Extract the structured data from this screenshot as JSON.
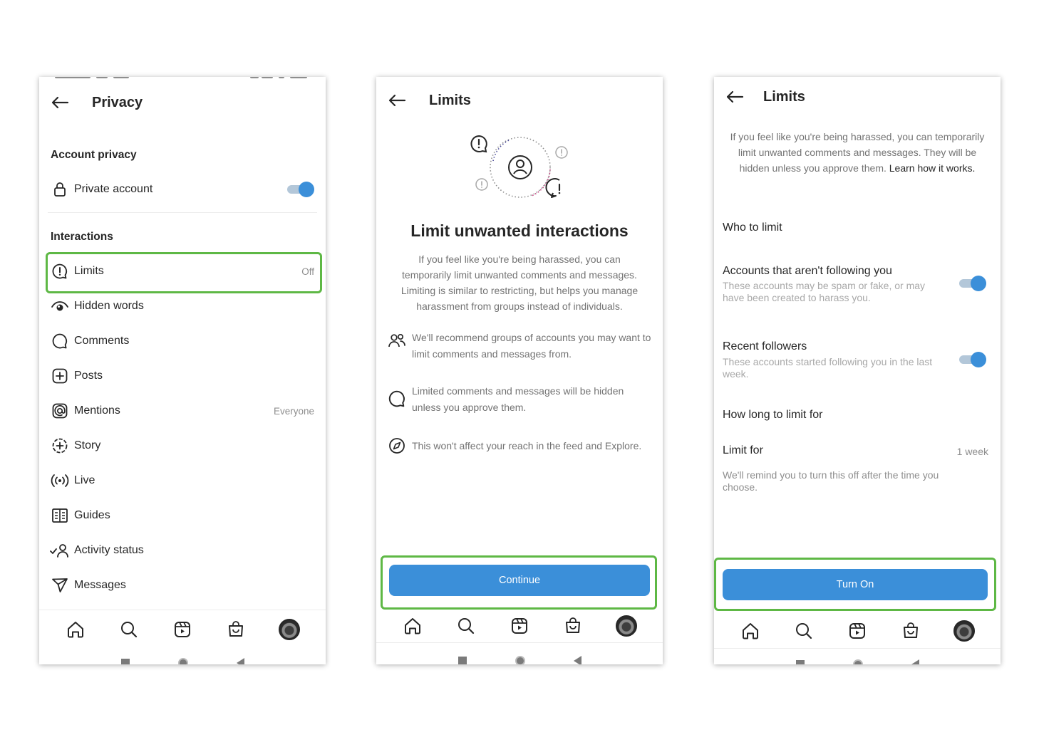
{
  "privacy_screen": {
    "title": "Privacy",
    "account_privacy_header": "Account privacy",
    "private_account_label": "Private account",
    "private_account_enabled": true,
    "interactions_header": "Interactions",
    "items": [
      {
        "label": "Limits",
        "value": "Off",
        "icon": "limits-icon"
      },
      {
        "label": "Hidden words",
        "value": "",
        "icon": "eye-icon"
      },
      {
        "label": "Comments",
        "value": "",
        "icon": "comment-icon"
      },
      {
        "label": "Posts",
        "value": "",
        "icon": "add-square-icon"
      },
      {
        "label": "Mentions",
        "value": "Everyone",
        "icon": "at-icon"
      },
      {
        "label": "Story",
        "value": "",
        "icon": "story-add-icon"
      },
      {
        "label": "Live",
        "value": "",
        "icon": "live-icon"
      },
      {
        "label": "Guides",
        "value": "",
        "icon": "guides-icon"
      },
      {
        "label": "Activity status",
        "value": "",
        "icon": "activity-status-icon"
      },
      {
        "label": "Messages",
        "value": "",
        "icon": "messages-icon"
      }
    ]
  },
  "limits_intro_screen": {
    "title": "Limits",
    "heading": "Limit unwanted interactions",
    "description": "If you feel like you're being harassed, you can temporarily limit unwanted comments and messages. Limiting is similar to restricting, but helps you manage harassment from groups instead of individuals.",
    "features": [
      {
        "icon": "people-icon",
        "text": "We'll recommend groups of accounts you may want to limit comments and messages from."
      },
      {
        "icon": "comment-icon",
        "text": "Limited comments and messages will be hidden unless you approve them."
      },
      {
        "icon": "compass-icon",
        "text": "This won't affect your reach in the feed and Explore."
      }
    ],
    "continue_label": "Continue"
  },
  "limits_settings_screen": {
    "title": "Limits",
    "description_main": "If you feel like you're being harassed, you can temporarily limit unwanted comments and messages. They will be hidden unless you approve them.",
    "learn_link": "Learn how it works.",
    "who_header": "Who to limit",
    "options": [
      {
        "title": "Accounts that aren't following you",
        "desc": "These accounts may be spam or fake, or may have been created to harass you.",
        "enabled": true
      },
      {
        "title": "Recent followers",
        "desc": "These accounts started following you in the last week.",
        "enabled": true
      }
    ],
    "how_long_header": "How long to limit for",
    "limit_for_label": "Limit for",
    "limit_for_value": "1 week",
    "reminder": "We'll remind you to turn this off after the time you choose.",
    "turn_on_label": "Turn On"
  },
  "nav_icons": [
    "home-icon",
    "search-icon",
    "reels-icon",
    "shop-icon",
    "profile-avatar"
  ],
  "colors": {
    "accent": "#3b8fd9",
    "highlight": "#5eb845",
    "text": "#262626",
    "muted": "#8e8e8e"
  }
}
